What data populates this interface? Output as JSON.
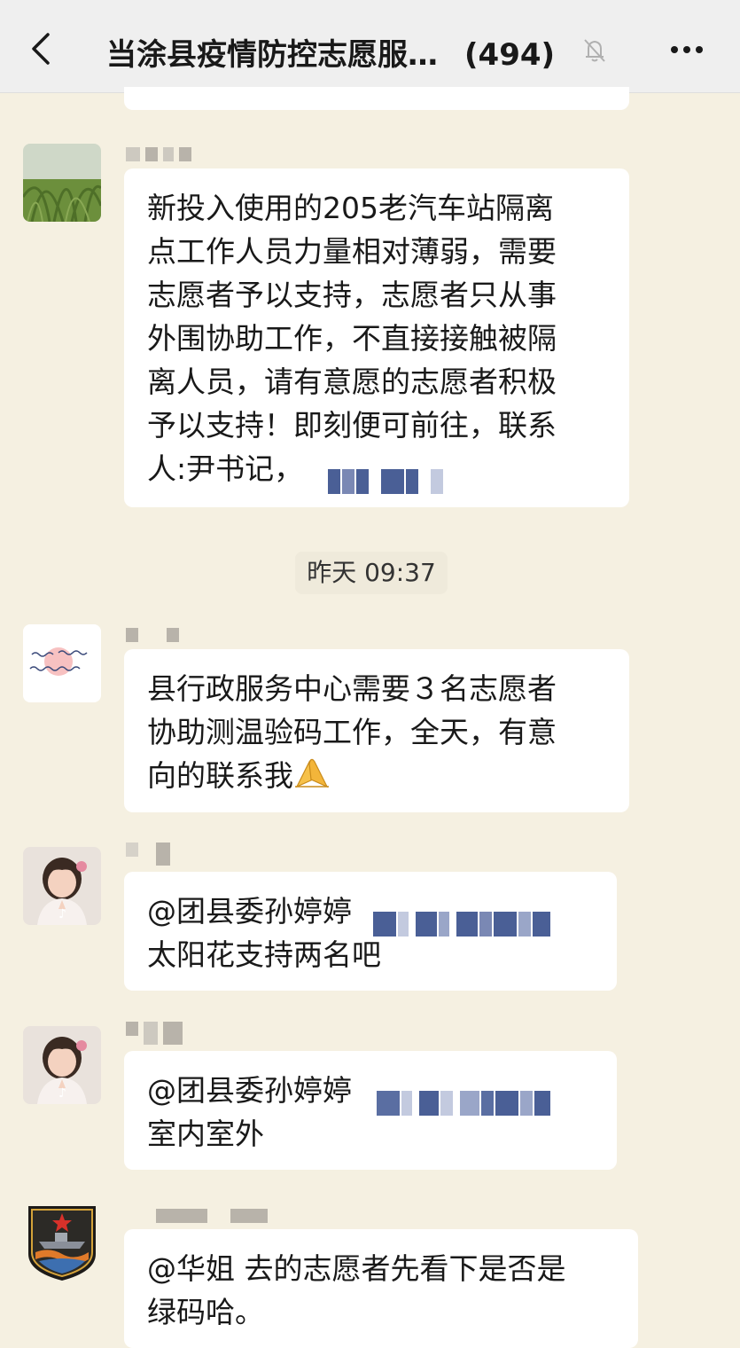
{
  "header": {
    "back_icon": "chevron-left-icon",
    "title": "当涂县疫情防控志愿服…",
    "member_count": "(494)",
    "mute_icon": "bell-slash-icon",
    "more_icon": "ellipsis-icon"
  },
  "messages": [
    {
      "avatar": "grass-photo-avatar",
      "text_lines": [
        "新投入使用的205老汽车站隔离",
        "点工作人员力量相对薄弱，需要",
        "志愿者予以支持，志愿者只从事",
        "外围协助工作，不直接接触被隔",
        "离人员，请有意愿的志愿者积极",
        "予以支持！即刻便可前往，联系",
        "人:尹书记，"
      ]
    },
    {
      "avatar": "handwriting-avatar",
      "text_lines": [
        "县行政服务中心需要３名志愿者",
        "协助测温验码工作，全天，有意",
        "向的联系我"
      ],
      "emoji": "folded-hands-emoji"
    },
    {
      "avatar": "girl-photo-avatar",
      "text_lines": [
        "@团县委孙婷婷",
        "太阳花支持两名吧"
      ]
    },
    {
      "avatar": "girl-photo-avatar",
      "text_lines": [
        "@团县委孙婷婷",
        "室内室外"
      ]
    },
    {
      "avatar": "navy-badge-avatar",
      "text_lines": [
        "@华姐 去的志愿者先看下是否是",
        "绿码哈。"
      ]
    }
  ],
  "timestamp": "昨天 09:37",
  "colors": {
    "chat_background": "#f5f0e1",
    "header_background": "#efefef",
    "bubble": "#ffffff",
    "mosaic": "#4a5f96"
  }
}
